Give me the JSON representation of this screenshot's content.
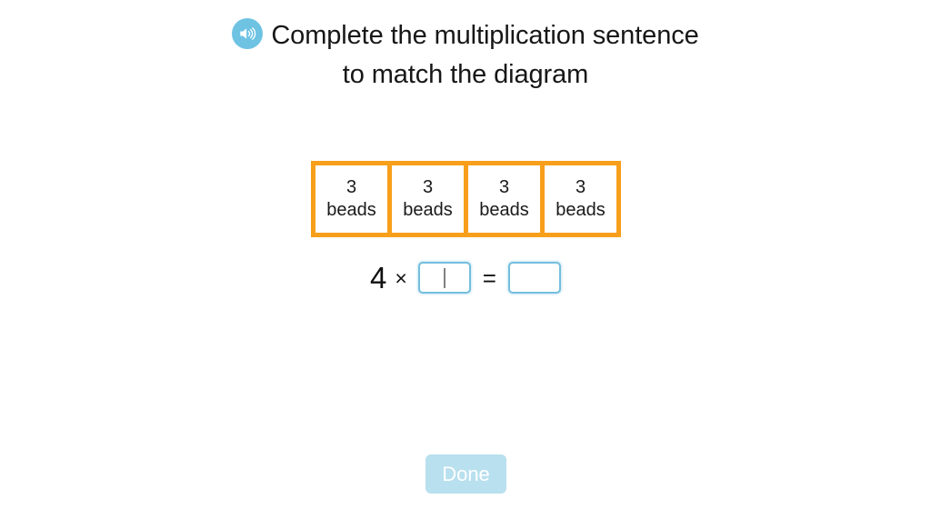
{
  "page": {
    "background_color": "#ffffff"
  },
  "header": {
    "audio_icon": "speaker-icon",
    "title_line_1": "Complete the multiplication sentence",
    "title_line_2": "to match the diagram",
    "icon_color": "#6ec3e3"
  },
  "diagram": {
    "border_color": "#f79f1b",
    "cells": [
      {
        "count": "3",
        "unit": "beads"
      },
      {
        "count": "3",
        "unit": "beads"
      },
      {
        "count": "3",
        "unit": "beads"
      },
      {
        "count": "3",
        "unit": "beads"
      }
    ]
  },
  "equation": {
    "factor": "4",
    "times_symbol": "×",
    "equals_symbol": "=",
    "input_border_color": "#74bedd",
    "inputs": [
      {
        "name": "factor-input",
        "value": "",
        "placeholder": "",
        "focused": true
      },
      {
        "name": "product-input",
        "value": "",
        "placeholder": "",
        "focused": false
      }
    ]
  },
  "footer": {
    "done_label": "Done",
    "done_enabled": false,
    "done_color": "#b9e0ee",
    "done_text_color": "#ffffff"
  }
}
